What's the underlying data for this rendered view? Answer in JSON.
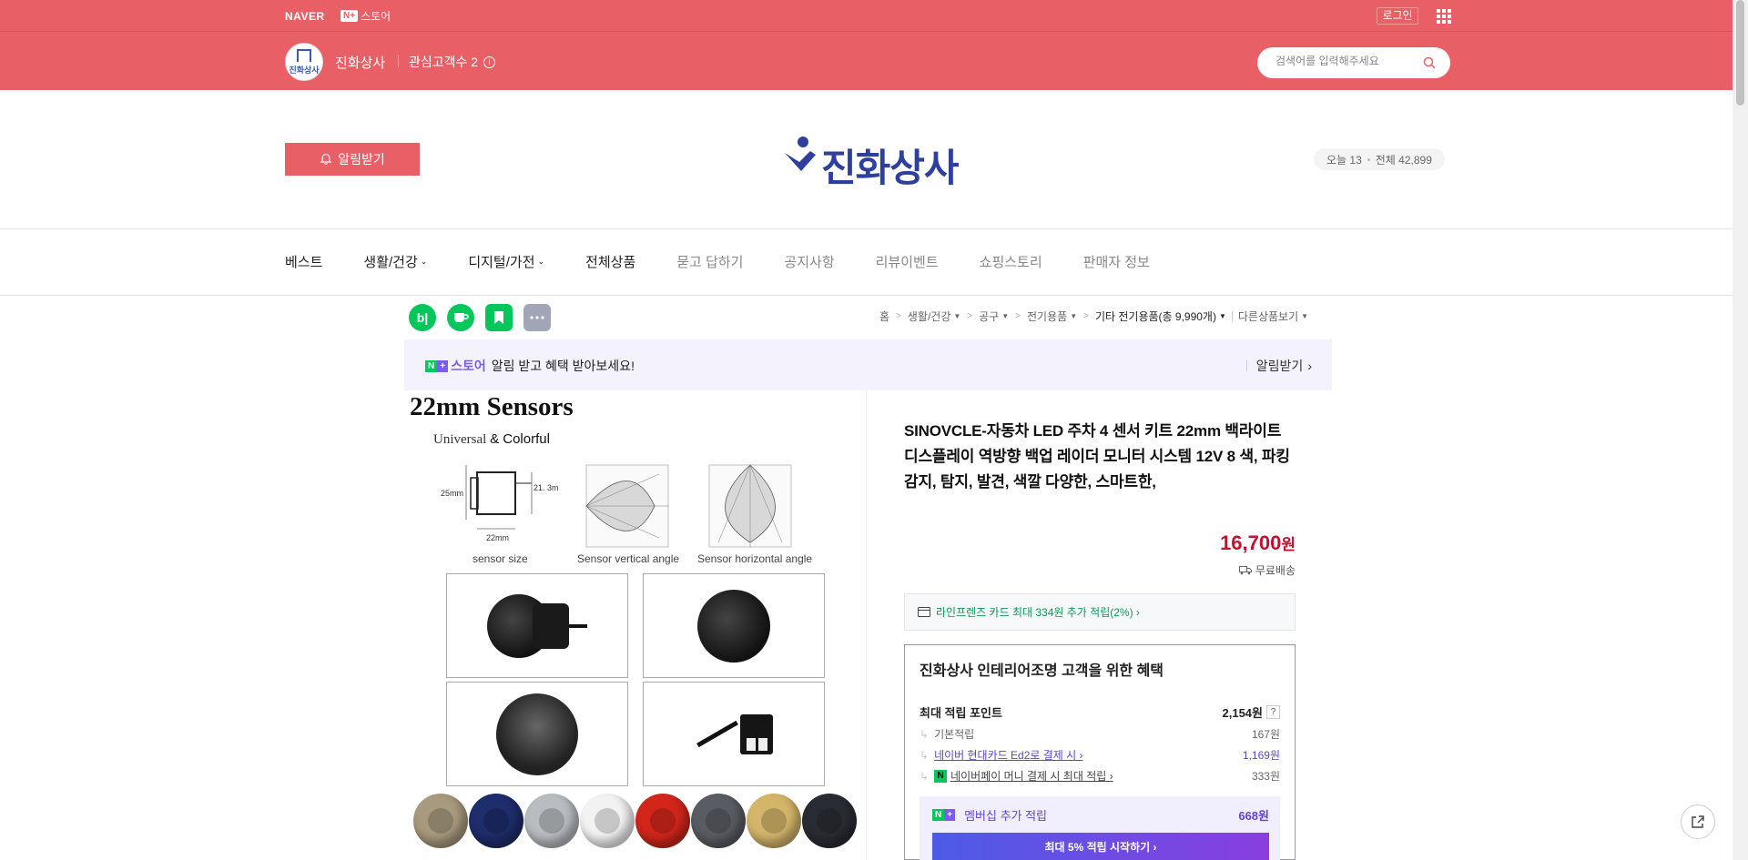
{
  "topbar": {
    "naver_logo": "NAVER",
    "nplus_badge": "N+",
    "nplus_store": "스토어",
    "login": "로그인",
    "grid_icon": "apps-grid-icon"
  },
  "store": {
    "avatar_text": "진화상사",
    "name": "진화상사",
    "followers": "관심고객수 2",
    "search_placeholder": "검색어를 입력해주세요"
  },
  "header": {
    "alarm_button": "알림받기",
    "brand": "진화상사",
    "visits_today": "오늘 13",
    "visits_total": "전체 42,899"
  },
  "nav": {
    "items": [
      {
        "label": "베스트",
        "dropdown": false,
        "muted": false
      },
      {
        "label": "생활/건강",
        "dropdown": true,
        "muted": false
      },
      {
        "label": "디지털/가전",
        "dropdown": true,
        "muted": false
      },
      {
        "label": "전체상품",
        "dropdown": false,
        "muted": false
      },
      {
        "label": "묻고 답하기",
        "dropdown": false,
        "muted": true
      },
      {
        "label": "공지사항",
        "dropdown": false,
        "muted": true
      },
      {
        "label": "리뷰이벤트",
        "dropdown": false,
        "muted": true
      },
      {
        "label": "쇼핑스토리",
        "dropdown": false,
        "muted": true
      },
      {
        "label": "판매자 정보",
        "dropdown": false,
        "muted": true
      }
    ]
  },
  "share": {
    "blog": "b|",
    "colors": {
      "blog": "#03c75a",
      "cafe": "#03c75a",
      "keep": "#03c75a",
      "more": "#a0a6b8"
    }
  },
  "breadcrumb": {
    "home": "홈",
    "c1": "생활/건강",
    "c2": "공구",
    "c3": "전기용품",
    "c4": "기타 전기용품(총 9,990개)",
    "other": "다른상품보기"
  },
  "notice": {
    "n": "N",
    "plus": "+",
    "store": "스토어",
    "text": "알림 받고 혜택 받아보세요!",
    "right": "알림받기"
  },
  "image": {
    "title": "22mm  Sensors",
    "sub_a": "Universal ",
    "sub_b": "& Colorful",
    "dim_h": "25mm",
    "dim_w": "22mm",
    "dim_d": "21. 3mm",
    "cap1": "sensor size",
    "cap2": "Sensor vertical angle",
    "cap3": "Sensor horizontal angle",
    "cap_colors": [
      "#a89a7e",
      "#1e2d6b",
      "#b9bcc0",
      "#f2f2f2",
      "#d2261b",
      "#5a5c63",
      "#d4b56a",
      "#2a2c33"
    ]
  },
  "product": {
    "title": "SINOVCLE-자동차 LED 주차 4 센서 키트 22mm 백라이트 디스플레이 역방향 백업 레이더 모니터 시스템 12V 8 색, 파킹 감지, 탐지, 발견, 색깔 다양한, 스마트한,",
    "price": "16,700",
    "won": "원",
    "shipping": "무료배송",
    "card_benefit": "라인프렌즈 카드 최대 334원 추가 적립(2%) ›"
  },
  "benefit": {
    "title": "진화상사 인테리어조명 고객을 위한 혜택",
    "max_point_label": "최대 적립 포인트",
    "max_point_value": "2,154원",
    "q": "?",
    "rows": [
      {
        "label": "기본적립",
        "value": "167원"
      },
      {
        "label": "네이버 현대카드 Ed2로 결제 시 ›",
        "value": "1,169원"
      },
      {
        "label": "네이버페이 머니 결제 시 최대 적립 ›",
        "value": "333원"
      }
    ],
    "npay_glyph": "N",
    "membership_label": "멤버십 추가 적립",
    "membership_value": "668원",
    "membership_button": "최대 5% 적립 시작하기 ›"
  }
}
